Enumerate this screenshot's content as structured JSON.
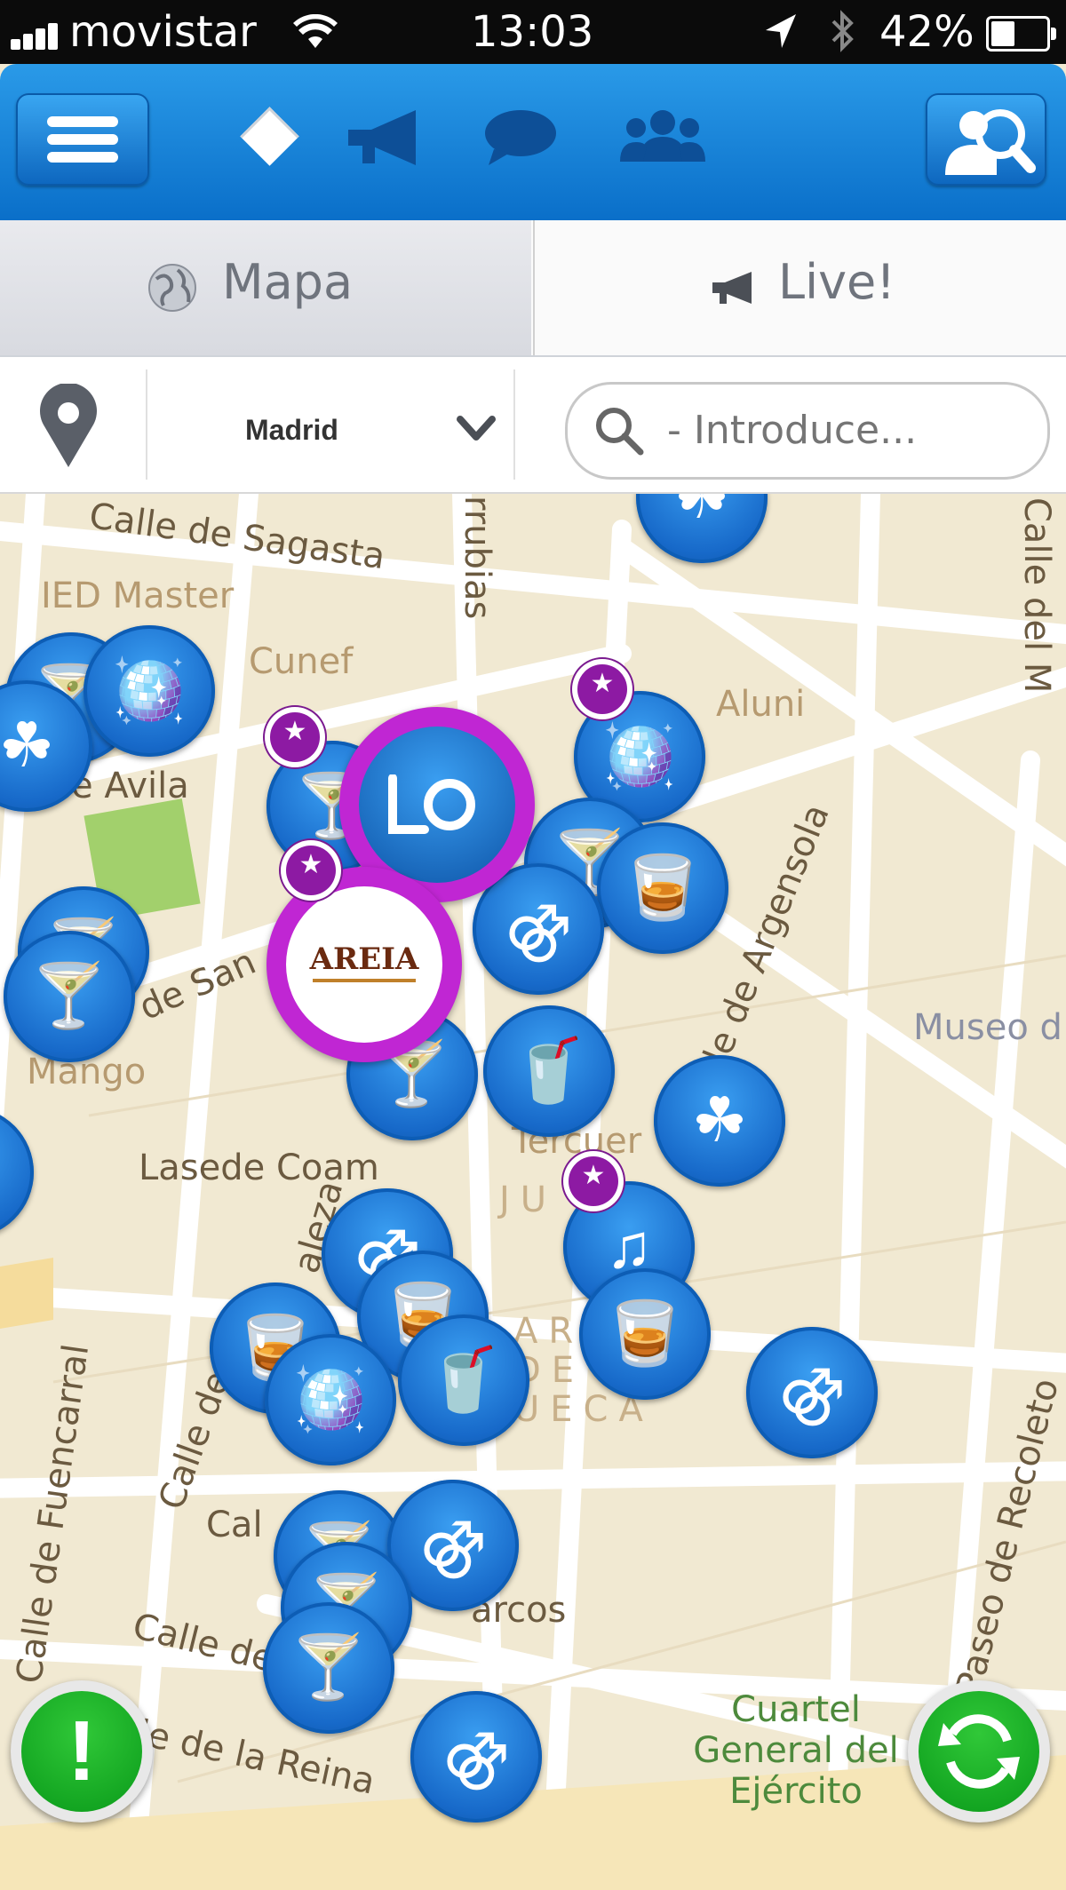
{
  "status_bar": {
    "carrier": "movistar",
    "time": "13:03",
    "battery": "42%"
  },
  "nav": {
    "icons": [
      "menu-icon",
      "megaphone-icon",
      "chat-bubble-icon",
      "people-icon",
      "search-user-icon"
    ]
  },
  "tabs": [
    {
      "label": "Mapa",
      "selected": true
    },
    {
      "label": "Live!",
      "selected": false
    }
  ],
  "filter": {
    "city": "Madrid",
    "search_placeholder": "- Introduce..."
  },
  "map": {
    "streets": [
      "Calle de Sagasta",
      "rrubias",
      "Calle del M",
      "de San",
      "Calle de Argensola",
      "Lasede Coam",
      "Calle de",
      "aleza",
      "Calle de Fuencarral",
      "Cal",
      "arcos",
      "Calle de las Inf",
      "lle de la Reina",
      "Paseo de Recoleto",
      "e Avila"
    ],
    "places": [
      "IED Master",
      "Cunef",
      "Aluni",
      "Mango",
      "Museo d",
      "Cuartel General del Ejército",
      "Tercuer",
      "JU    CA",
      "AR",
      "DE",
      "UECA"
    ],
    "featured_pin_text": "AREIA",
    "colors": {
      "pin_blue": "#1769c9",
      "featured_ring": "#c026d3",
      "star_badge": "#8d1aa3",
      "action_green": "#18b02a"
    }
  },
  "actions": {
    "alert_label": "!"
  }
}
